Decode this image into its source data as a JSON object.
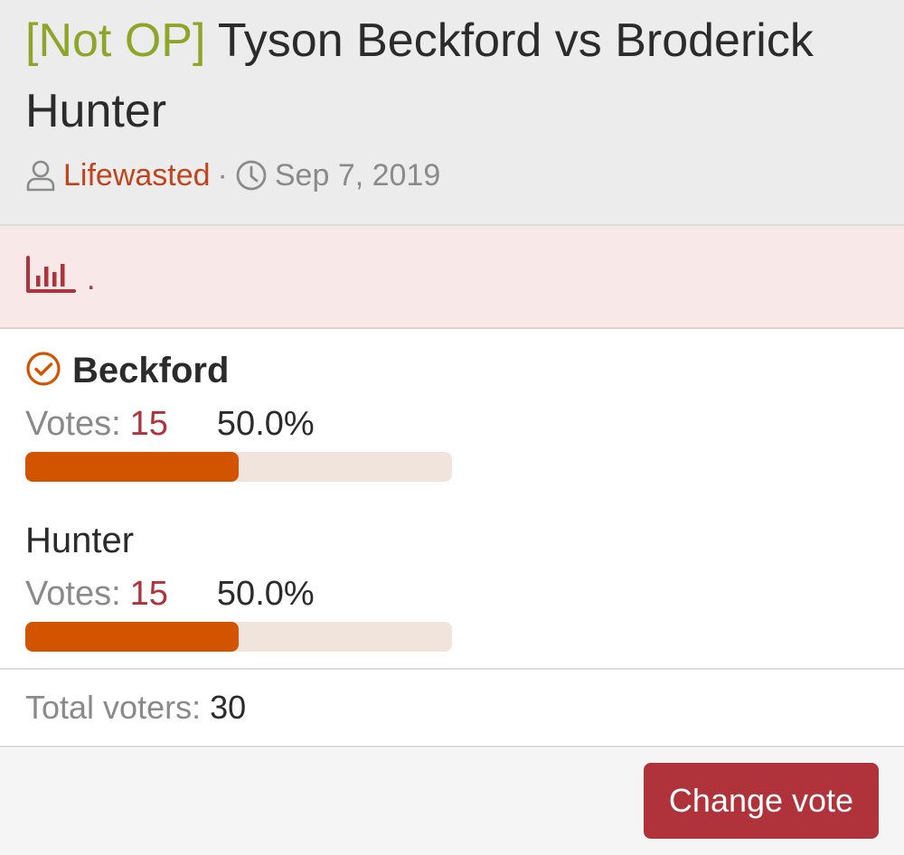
{
  "thread": {
    "prefix": "[Not OP]",
    "title": " Tyson Beckford vs Broderick Hunter",
    "author": "Lifewasted",
    "separator": "·",
    "date": "Sep 7, 2019"
  },
  "poll": {
    "title": ".",
    "options": [
      {
        "label": "Beckford",
        "votes_label": "Votes:",
        "votes": "15",
        "percent": "50.0%",
        "fraction": 0.5,
        "voted": true
      },
      {
        "label": "Hunter",
        "votes_label": "Votes:",
        "votes": "15",
        "percent": "50.0%",
        "fraction": 0.5,
        "voted": false
      }
    ],
    "total_label": "Total voters:",
    "total": "30",
    "change_vote_label": "Change vote"
  },
  "colors": {
    "prefix": "#8fa52a",
    "author": "#c0441c",
    "accent": "#b0323a",
    "bar": "#d35400"
  },
  "icons": {
    "author": "user-icon",
    "date": "clock-icon",
    "poll": "bar-chart-icon",
    "voted": "check-circle-icon"
  }
}
